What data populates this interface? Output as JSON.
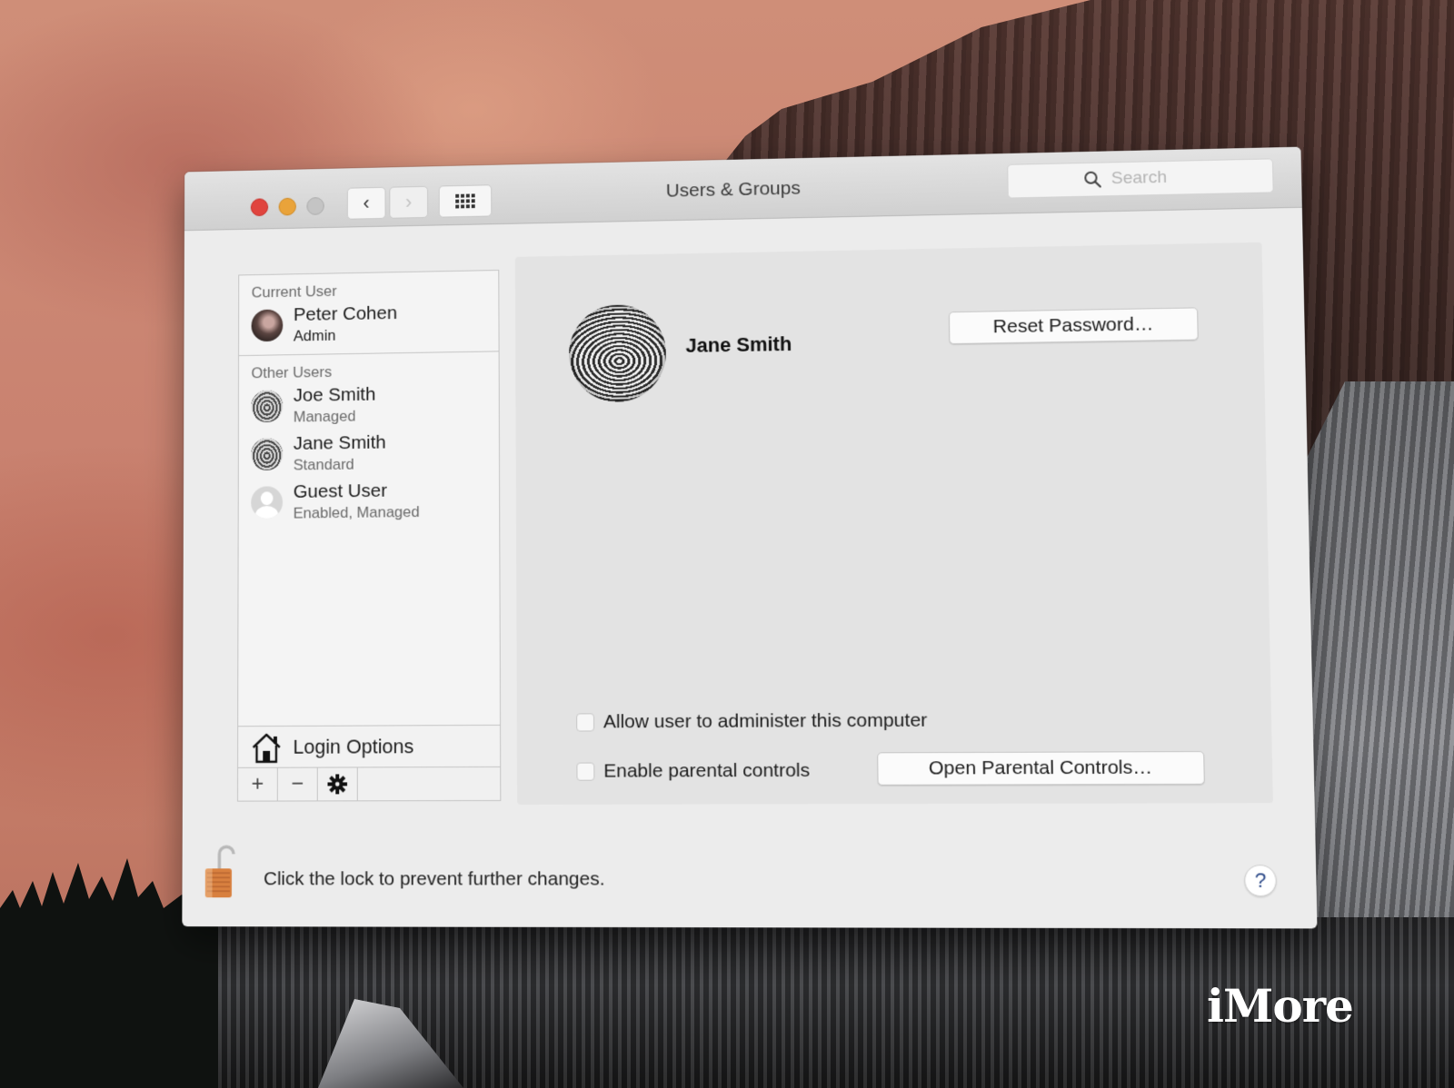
{
  "window": {
    "title": "Users & Groups",
    "traffic_lights": {
      "close": "#e0443e",
      "minimize": "#e9a33a",
      "zoom": "#c4c4c4"
    },
    "nav": {
      "back_icon": "chevron-left-icon",
      "forward_icon": "chevron-right-icon",
      "back_glyph": "‹",
      "forward_glyph": "›",
      "forward_enabled": false
    },
    "show_all_icon": "grid-icon",
    "search": {
      "placeholder": "Search",
      "value": ""
    }
  },
  "sidebar": {
    "current_user_header": "Current User",
    "current_user": {
      "name": "Peter Cohen",
      "role": "Admin"
    },
    "other_users_header": "Other Users",
    "other_users": [
      {
        "name": "Joe Smith",
        "role": "Managed"
      },
      {
        "name": "Jane Smith",
        "role": "Standard"
      },
      {
        "name": "Guest User",
        "role": "Enabled, Managed"
      }
    ],
    "login_options_label": "Login Options",
    "toolbar": {
      "add": "+",
      "remove": "−",
      "action": "✱"
    }
  },
  "detail": {
    "selected_user_name": "Jane Smith",
    "reset_password_label": "Reset Password…",
    "allow_admin_label": "Allow user to administer this computer",
    "allow_admin_checked": false,
    "parental_controls_label": "Enable parental controls",
    "parental_controls_checked": false,
    "open_parental_controls_label": "Open Parental Controls…"
  },
  "footer": {
    "lock_state": "unlocked",
    "lock_text": "Click the lock to prevent further changes.",
    "help_label": "?"
  },
  "watermark": "iMore"
}
